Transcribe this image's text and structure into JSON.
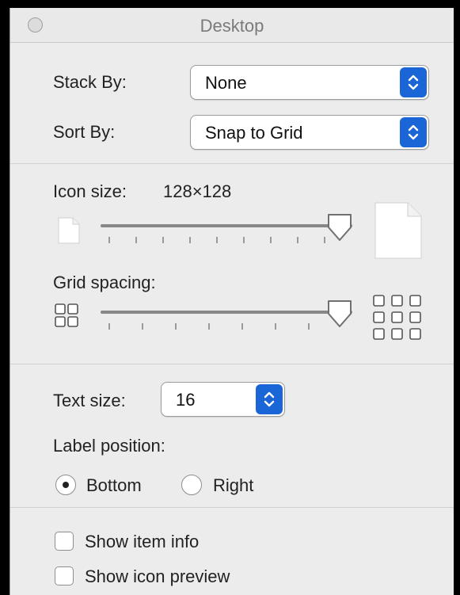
{
  "window": {
    "title": "Desktop"
  },
  "stack_by": {
    "label": "Stack By:",
    "value": "None"
  },
  "sort_by": {
    "label": "Sort By:",
    "value": "Snap to Grid"
  },
  "icon_size": {
    "label": "Icon size:",
    "value": "128×128",
    "slider_level": 1.0
  },
  "grid_spacing": {
    "label": "Grid spacing:",
    "slider_level": 1.0
  },
  "text_size": {
    "label": "Text size:",
    "value": "16"
  },
  "label_position": {
    "label": "Label position:",
    "options": [
      "Bottom",
      "Right"
    ],
    "selected": "Bottom"
  },
  "checkboxes": [
    {
      "label": "Show item info",
      "checked": false
    },
    {
      "label": "Show icon preview",
      "checked": false
    }
  ],
  "colors": {
    "accent": "#1a66d6",
    "panel_bg": "#ececec"
  }
}
